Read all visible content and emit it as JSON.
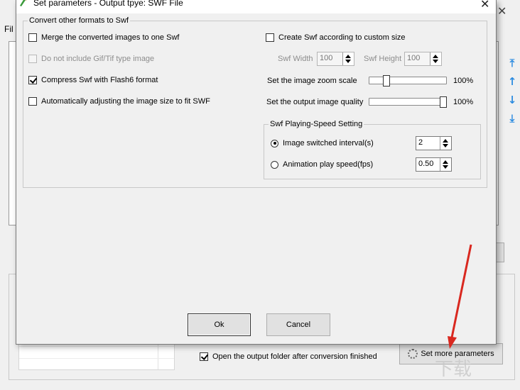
{
  "background": {
    "menu_file": "Fil",
    "open_output_label": "Open the output folder after conversion finished",
    "open_output_checked": true,
    "more_params_label": "Set more parameters",
    "watermark": "下载吧"
  },
  "dialog": {
    "title": "Set parameters - Output tpye: SWF File",
    "group_title": "Convert other formats to Swf",
    "merge_label": "Merge the converted images to one Swf",
    "merge_checked": false,
    "no_gif_label": "Do not include Gif/Tif type image",
    "no_gif_checked": false,
    "compress_label": "Compress Swf with Flash6 format",
    "compress_checked": true,
    "auto_adjust_label": "Automatically adjusting the image size to fit SWF",
    "auto_adjust_checked": false,
    "custom_size_label": "Create Swf according to custom size",
    "custom_size_checked": false,
    "width_label": "Swf Width",
    "width_value": "100",
    "height_label": "Swf Height",
    "height_value": "100",
    "zoom_label": "Set the image zoom scale",
    "zoom_value": "100%",
    "zoom_fraction": 0.2,
    "quality_label": "Set the output image quality",
    "quality_value": "100%",
    "quality_fraction": 1.0,
    "speed_group_title": "Swf Playing-Speed Setting",
    "interval_label": "Image switched interval(s)",
    "interval_value": "2",
    "interval_selected": true,
    "fps_label": "Animation play speed(fps)",
    "fps_value": "0.50",
    "fps_selected": false,
    "ok_label": "Ok",
    "cancel_label": "Cancel"
  },
  "colors": {
    "annotation_arrow": "#d9281f",
    "nav_arrow": "#2b8be0"
  },
  "icons": [
    "close-icon",
    "app-icon",
    "up-top-icon",
    "up-icon",
    "down-icon",
    "down-bottom-icon",
    "gear-icon",
    "spin-up-icon",
    "spin-down-icon"
  ]
}
